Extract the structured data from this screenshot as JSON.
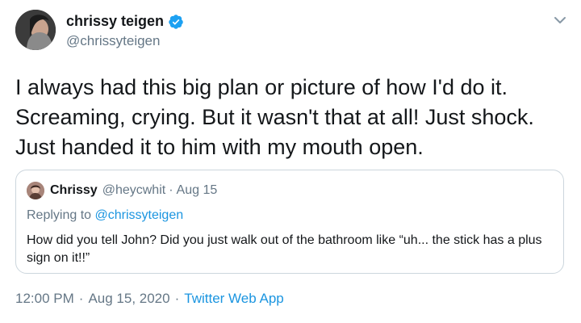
{
  "author": {
    "display_name": "chrissy teigen",
    "handle": "@chrissyteigen",
    "verified_icon": "verified-badge-icon",
    "avatar_icon": "profile-photo"
  },
  "tweet": {
    "text": "I always had this big plan or picture of how I'd do it.\nScreaming, crying. But it wasn't that at all! Just shock.\nJust handed it to him with my mouth open."
  },
  "quoted": {
    "display_name": "Chrissy",
    "handle": "@heycwhit",
    "separator": "·",
    "date": "Aug 15",
    "replying_prefix": "Replying to ",
    "replying_to": "@chrissyteigen",
    "text": "How did you tell John? Did you just walk out of the bathroom like “uh... the stick has a plus sign on it!!”"
  },
  "footer": {
    "time": "12:00 PM",
    "separator1": "·",
    "date": "Aug 15, 2020",
    "separator2": "·",
    "source": "Twitter Web App"
  },
  "colors": {
    "link": "#1b95e0",
    "secondary_text": "#657786",
    "border": "#ccd6dd",
    "verified": "#1da1f2"
  }
}
